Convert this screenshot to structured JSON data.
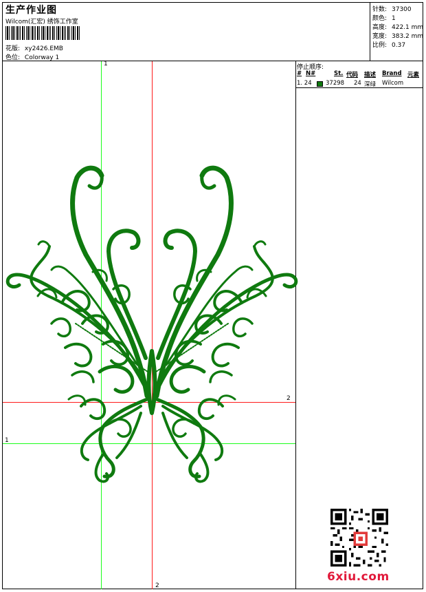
{
  "header": {
    "title": "生产作业图",
    "studio": "Wilcom(汇宏) 绣饰工作室",
    "design_label": "花版:",
    "design_value": "xy2426.EMB",
    "color_label": "色位:",
    "color_value": "Colorway 1"
  },
  "info": {
    "stitches_label": "针数:",
    "stitches_value": "37300",
    "colors_label": "颜色:",
    "colors_value": "1",
    "height_label": "高度:",
    "height_value": "422.1 mm",
    "width_label": "宽度:",
    "width_value": "383.2 mm",
    "scale_label": "比例:",
    "scale_value": "0.37"
  },
  "stop_sequence": {
    "title": "停止顺序:",
    "headers": [
      "#",
      "N#",
      "St.",
      "代码",
      "描述",
      "Brand",
      "元素"
    ],
    "rows": [
      {
        "index": "1. 24",
        "swatch_color": "#0f7a0f",
        "code": "37298",
        "stitch_count": "24",
        "description": "深绿",
        "brand": "Wilcom"
      }
    ]
  },
  "guides": {
    "v_green_label": "1",
    "h_green_label": "1",
    "v_red_label": "2",
    "h_red_label": "2"
  },
  "colors": {
    "thread": "#0f7a0f",
    "guide_green": "#19ff19",
    "guide_red": "#ff1a1a",
    "watermark": "#e1193a"
  },
  "watermark": "6xiu.com"
}
